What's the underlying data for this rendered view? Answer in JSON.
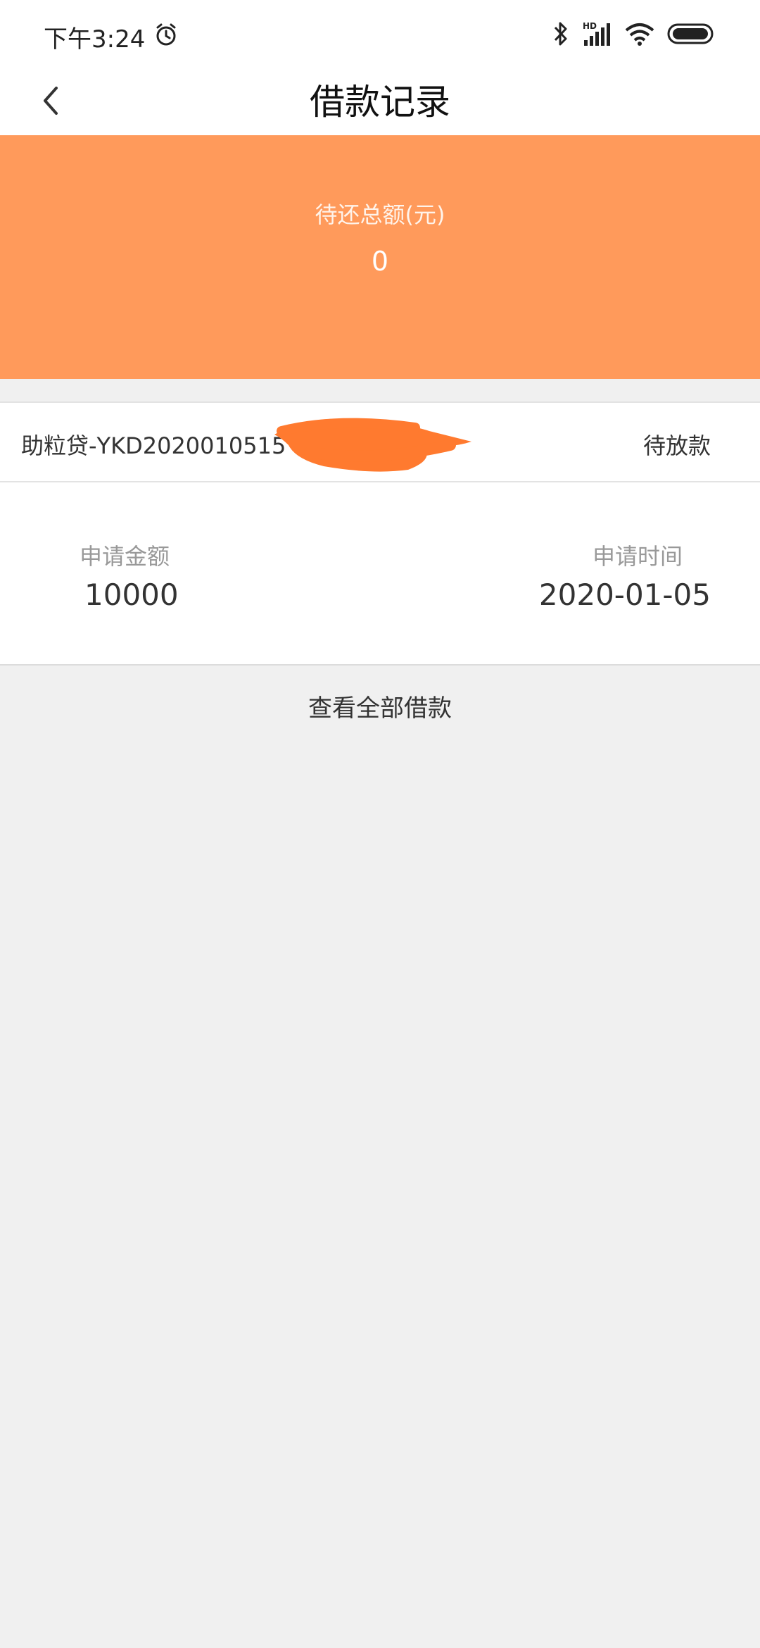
{
  "status_bar": {
    "time": "下午3:24",
    "icons": [
      "alarm-icon",
      "bluetooth-icon",
      "hd-signal-icon",
      "wifi-icon",
      "battery-icon"
    ]
  },
  "header": {
    "title": "借款记录",
    "back_icon": "chevron-left-icon"
  },
  "summary": {
    "label": "待还总额(元)",
    "amount": "0",
    "background_color": "#ff9a5b"
  },
  "loan": {
    "id_text": "助粒贷-YKD2020010515",
    "status": "待放款",
    "amount_label": "申请金额",
    "amount_value": "10000",
    "time_label": "申请时间",
    "time_value": "2020-01-05"
  },
  "view_all_label": "查看全部借款"
}
